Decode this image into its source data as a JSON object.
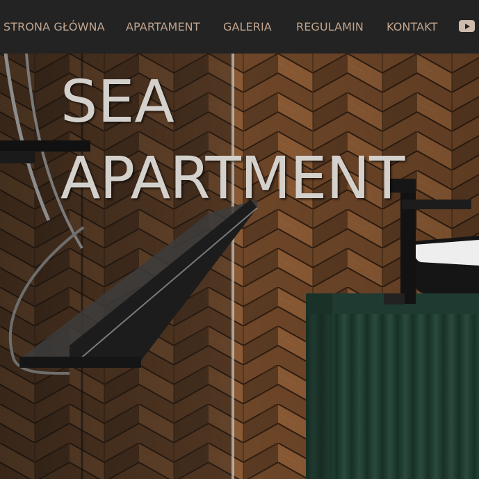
{
  "nav": {
    "items": [
      {
        "id": "home",
        "label": "STRONA GŁÓWNA"
      },
      {
        "id": "apartment",
        "label": "APARTAMENT"
      },
      {
        "id": "gallery",
        "label": "GALERIA"
      },
      {
        "id": "rules",
        "label": "REGULAMIN"
      },
      {
        "id": "contact",
        "label": "KONTAKT"
      }
    ],
    "social_icon": "youtube-icon"
  },
  "hero": {
    "title_line1": "SEA",
    "title_line2": "APARTMENT"
  },
  "colors": {
    "nav_background": "#232323",
    "nav_text": "#c2a58f",
    "title_text": "#d4d1cd",
    "cabinet_green": "#1f3a30"
  }
}
